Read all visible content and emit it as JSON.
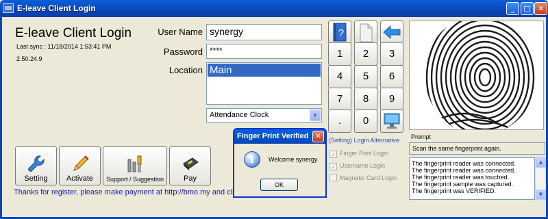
{
  "window": {
    "title": "E-leave Client Login",
    "minimize": "_",
    "maximize": "□",
    "close": "✕"
  },
  "app": {
    "heading": "E-leave Client Login",
    "last_sync": "Last sync : 11/18/2014 1:53:41 PM",
    "version": "2.50.24.9"
  },
  "form": {
    "username_label": "User Name",
    "username_value": "synergy",
    "password_label": "Password",
    "password_value": "****",
    "location_label": "Location",
    "location_selected": "Main",
    "clock_value": "Attendance Clock"
  },
  "keypad": {
    "keys": [
      "1",
      "2",
      "3",
      "4",
      "5",
      "6",
      "7",
      "8",
      "9",
      ".",
      "0"
    ]
  },
  "fingerprint": {
    "prompt_label": "Prompt",
    "prompt_text": "Scan the same fingerprint again.",
    "log": [
      "The fingerprint reader was connected.",
      "The fingerprint reader was connected.",
      "The fingerprint reader was touched.",
      "The fingerprint sample was captured.",
      "The fingerprint was VERIFIED."
    ]
  },
  "alternatives": {
    "title": "(Setting) Login Alternative",
    "options": [
      {
        "label": "Finger Print Login",
        "checked": "✓"
      },
      {
        "label": "Username Login",
        "checked": "✓"
      },
      {
        "label": "Magnetic Card Login",
        "checked": ""
      }
    ]
  },
  "actions": {
    "setting": "Setting",
    "activate": "Activate",
    "support": "Support / Suggestion",
    "pay": "Pay"
  },
  "thanks_text": "Thanks for register, please make payment at http://bmo.my and cli",
  "dialog": {
    "title": "Finger Print Verified",
    "message": "Welcome synergy",
    "ok": "OK",
    "close": "✕",
    "icon": "i"
  },
  "colors": {
    "titlebar": "#0845b8",
    "selection": "#316ac5",
    "link": "#1818b8"
  }
}
